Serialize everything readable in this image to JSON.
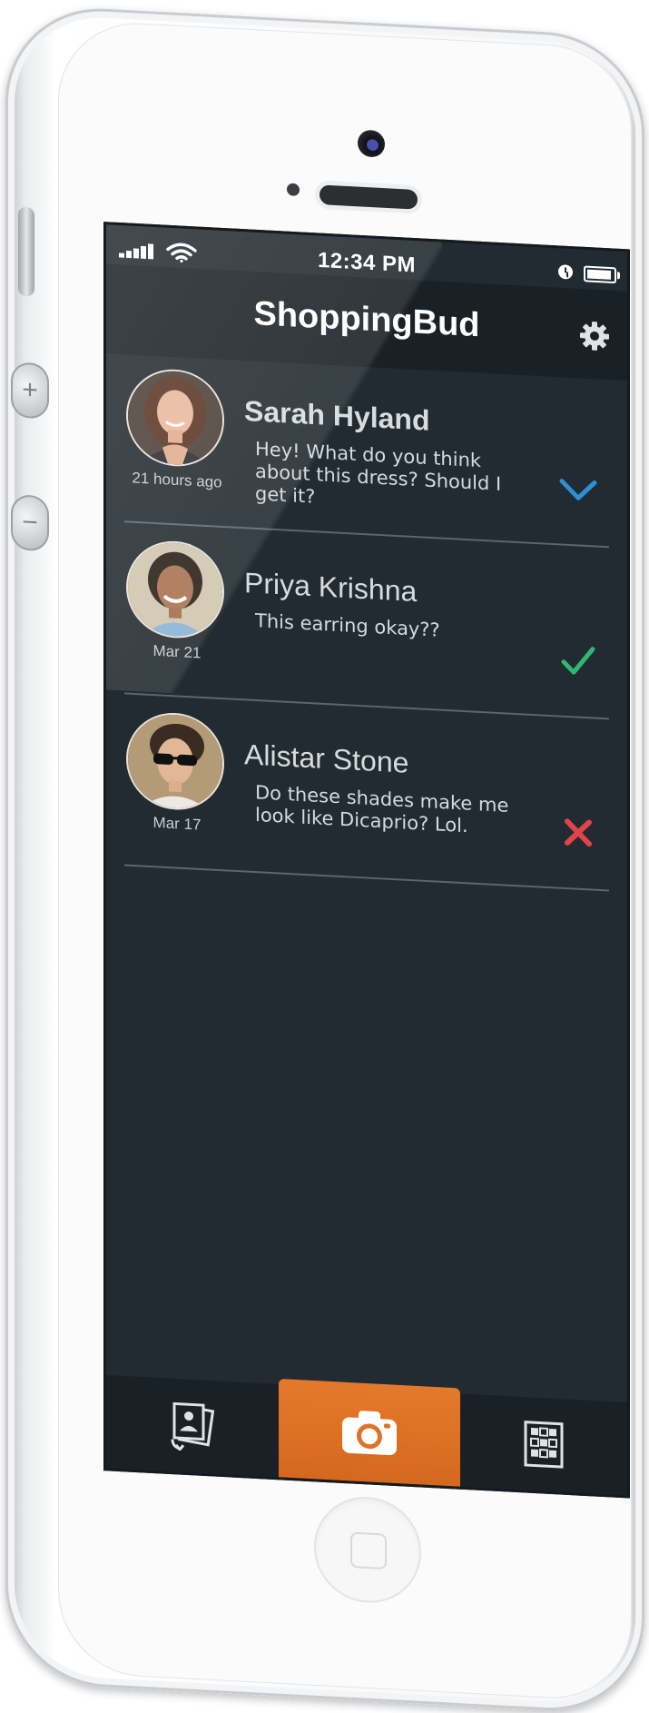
{
  "status_bar": {
    "time": "12:34 PM"
  },
  "app": {
    "title": "ShoppingBud"
  },
  "conversations": [
    {
      "name": "Sarah Hyland",
      "message": "Hey! What do you think about this dress? Should I get it?",
      "date": "21 hours ago",
      "status_icon": "chevron-check-icon",
      "status_color": "#2f8fd6"
    },
    {
      "name": "Priya Krishna",
      "message": "This earring okay??",
      "date": "Mar 21",
      "status_icon": "check-icon",
      "status_color": "#2fb86f"
    },
    {
      "name": "Alistar Stone",
      "message": "Do these shades make me look like Dicaprio? Lol.",
      "date": "Mar 17",
      "status_icon": "cross-icon",
      "status_color": "#e0444a"
    }
  ],
  "tab_bar": {
    "tabs": [
      {
        "icon": "photo-stack-icon"
      },
      {
        "icon": "camera-icon",
        "active": true
      },
      {
        "icon": "grid-icon"
      }
    ],
    "accent_color": "#e0712a"
  },
  "colors": {
    "screen_bg": "#222b31",
    "header_bg": "#1a2126",
    "divider": "#5b6670"
  }
}
